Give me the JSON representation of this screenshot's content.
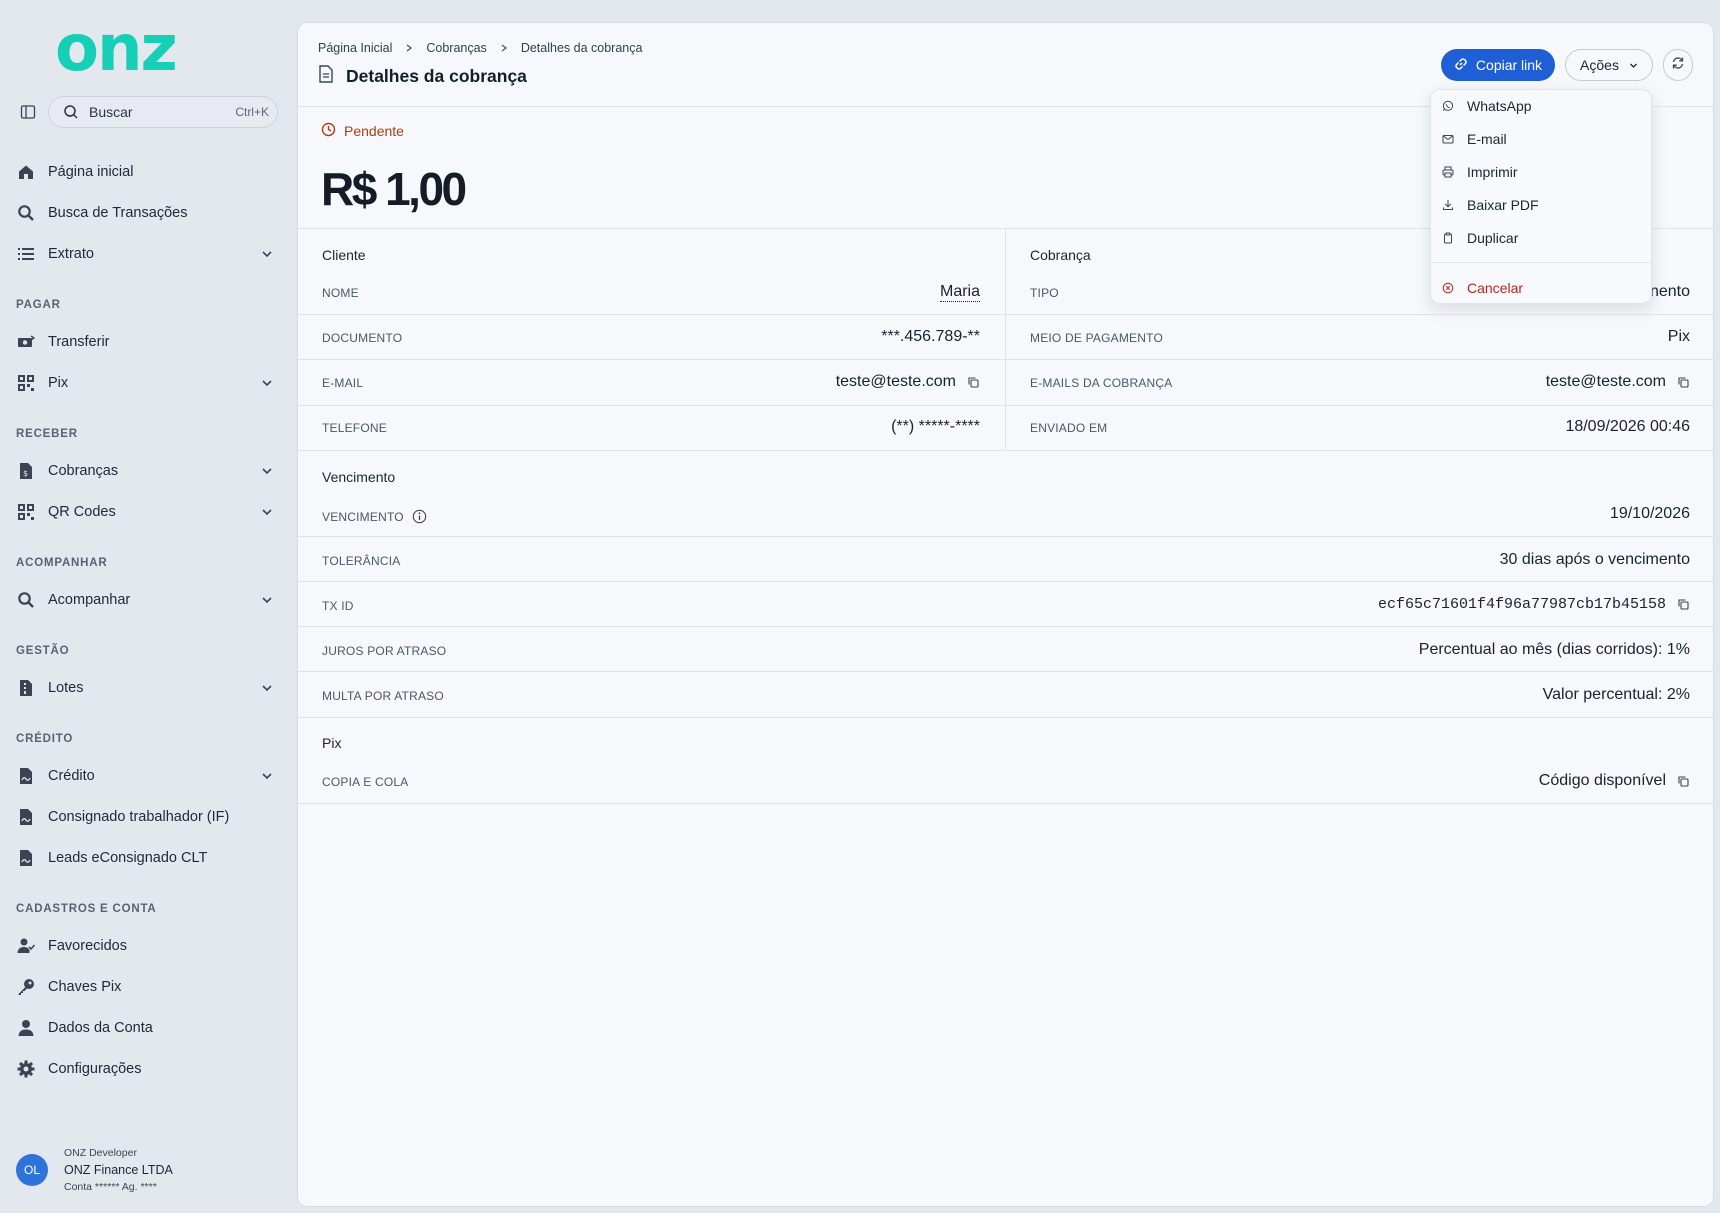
{
  "logo": "onz",
  "search": {
    "label": "Buscar",
    "shortcut": "Ctrl+K"
  },
  "nav": {
    "home": "Página inicial",
    "tx_search": "Busca de Transações",
    "extrato": "Extrato",
    "section_pagar": "PAGAR",
    "transferir": "Transferir",
    "pix": "Pix",
    "section_receber": "RECEBER",
    "cobrancas": "Cobranças",
    "qrcodes": "QR Codes",
    "section_acompanhar": "ACOMPANHAR",
    "acompanhar": "Acompanhar",
    "section_gestao": "GESTÃO",
    "lotes": "Lotes",
    "section_credito": "CRÉDITO",
    "credito": "Crédito",
    "consignado": "Consignado trabalhador (IF)",
    "leads": "Leads eConsignado CLT",
    "section_cadastros": "CADASTROS E CONTA",
    "favorecidos": "Favorecidos",
    "chaves_pix": "Chaves Pix",
    "dados_conta": "Dados da Conta",
    "configuracoes": "Configurações"
  },
  "user": {
    "initials": "OL",
    "role": "ONZ Developer",
    "company": "ONZ Finance LTDA",
    "account": "Conta ****** Ag. ****"
  },
  "breadcrumb": [
    "Página Inicial",
    "Cobranças",
    "Detalhes da cobrança"
  ],
  "page_title": "Detalhes da cobrança",
  "buttons": {
    "copy_link": "Copiar link",
    "actions": "Ações"
  },
  "status": "Pendente",
  "amount": "R$ 1,00",
  "client": {
    "title": "Cliente",
    "nome_label": "NOME",
    "nome": "Maria",
    "documento_label": "DOCUMENTO",
    "documento": "***.456.789-**",
    "email_label": "E-MAIL",
    "email": "teste@teste.com",
    "telefone_label": "TELEFONE",
    "telefone": "(**) *****-****"
  },
  "charge": {
    "title": "Cobrança",
    "tipo_label": "TIPO",
    "tipo_partial": "nento",
    "meio_label": "MEIO DE PAGAMENTO",
    "meio": "Pix",
    "emails_label": "E-MAILS DA COBRANÇA",
    "emails": "teste@teste.com",
    "enviado_label": "ENVIADO EM",
    "enviado": "18/09/2026 00:46"
  },
  "due": {
    "title": "Vencimento",
    "vencimento_label": "VENCIMENTO",
    "vencimento": "19/10/2026",
    "tolerancia_label": "TOLERÂNCIA",
    "tolerancia": "30 dias após o vencimento",
    "txid_label": "TX ID",
    "txid": "ecf65c71601f4f96a77987cb17b45158",
    "juros_label": "JUROS POR ATRASO",
    "juros": "Percentual ao mês (dias corridos): 1%",
    "multa_label": "MULTA POR ATRASO",
    "multa": "Valor percentual: 2%"
  },
  "pix": {
    "title": "Pix",
    "copia_label": "COPIA E COLA",
    "copia": "Código disponível"
  },
  "dropdown": {
    "whatsapp": "WhatsApp",
    "email": "E-mail",
    "imprimir": "Imprimir",
    "pdf": "Baixar PDF",
    "duplicar": "Duplicar",
    "cancelar": "Cancelar"
  }
}
